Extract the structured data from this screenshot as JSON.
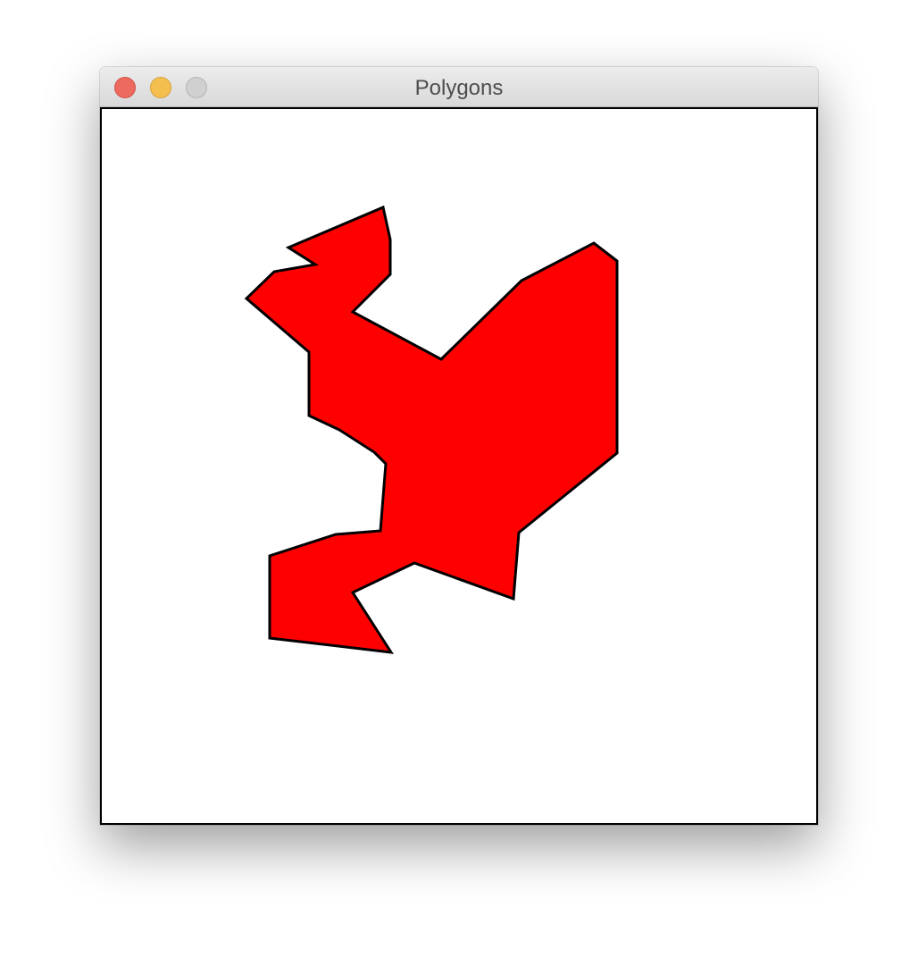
{
  "window": {
    "title": "Polygons"
  },
  "traffic_lights": {
    "close": {
      "icon": "close-dot-icon",
      "color": "#ed6a5e",
      "border": "#d0524a"
    },
    "minimize": {
      "icon": "minimize-dot-icon",
      "color": "#f5bf4f",
      "border": "#d6a23c"
    },
    "zoom": {
      "icon": "zoom-dot-icon",
      "color": "#d0d0d0",
      "border": "#b5b5b5"
    }
  },
  "polygon": {
    "fill": "#ff0000",
    "stroke": "#000000"
  }
}
